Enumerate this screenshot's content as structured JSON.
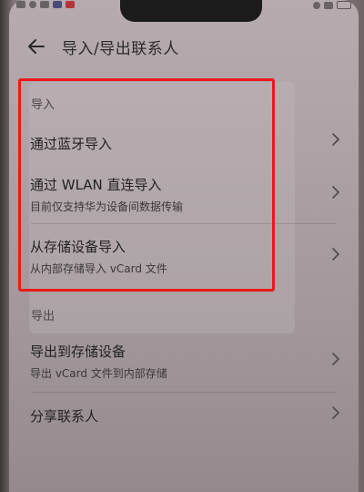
{
  "header": {
    "title": "导入/导出联系人"
  },
  "import_section": {
    "label": "导入",
    "items": [
      {
        "title": "通过蓝牙导入",
        "subtitle": ""
      },
      {
        "title": "通过 WLAN 直连导入",
        "subtitle": "目前仅支持华为设备间数据传输"
      },
      {
        "title": "从存储设备导入",
        "subtitle": "从内部存储导入 vCard 文件"
      }
    ]
  },
  "export_section": {
    "label": "导出",
    "items": [
      {
        "title": "导出到存储设备",
        "subtitle": "导出 vCard 文件到内部存储"
      },
      {
        "title": "分享联系人",
        "subtitle": ""
      }
    ]
  },
  "colors": {
    "highlight": "#e81a1a",
    "screen_bg": "#ada2a6"
  },
  "icons": {
    "back": "back-arrow-icon",
    "chevron": "chevron-right-icon"
  }
}
